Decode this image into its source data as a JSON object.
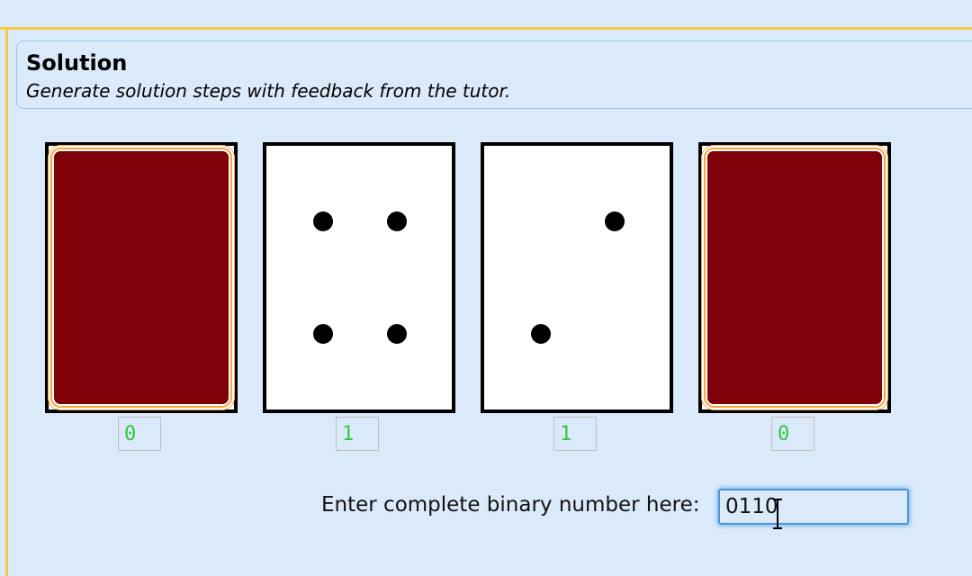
{
  "header": {
    "title": "Solution",
    "subtitle": "Generate solution steps with feedback from the tutor."
  },
  "cards": [
    {
      "face": "back",
      "dots": 0
    },
    {
      "face": "front",
      "dots": 4
    },
    {
      "face": "front",
      "dots": 2
    },
    {
      "face": "back",
      "dots": 0
    }
  ],
  "bits": [
    "0",
    "1",
    "1",
    "0"
  ],
  "answer": {
    "label": "Enter complete binary number here:",
    "value": "0110"
  },
  "colors": {
    "background": "#dbeafa",
    "accent_border": "#f4cc3c",
    "card_back": "#7f0208",
    "bit_text": "#2fc83c",
    "focus": "#4d93d9"
  },
  "icons": {
    "text_cursor": "i-beam-cursor-icon"
  }
}
